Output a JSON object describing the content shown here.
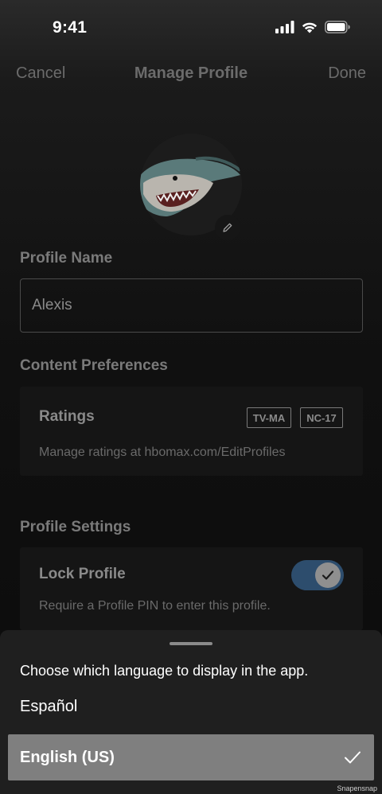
{
  "status_bar": {
    "time": "9:41"
  },
  "nav": {
    "cancel_label": "Cancel",
    "title": "Manage Profile",
    "done_label": "Done"
  },
  "profile_name": {
    "label": "Profile Name",
    "value": "Alexis"
  },
  "content_preferences": {
    "label": "Content Preferences",
    "ratings_title": "Ratings",
    "badges": [
      "TV-MA",
      "NC-17"
    ],
    "subtitle": "Manage ratings at hbomax.com/EditProfiles"
  },
  "profile_settings": {
    "label": "Profile Settings",
    "lock_title": "Lock Profile",
    "lock_subtitle": "Require a Profile PIN to enter this profile.",
    "lock_enabled": true
  },
  "language_sheet": {
    "description": "Choose which language to display in the app.",
    "options": [
      "Español",
      "English (US)"
    ],
    "selected": "English (US)"
  },
  "watermark": "Snapensnap",
  "colors": {
    "toggle_track": "#2d4d6d",
    "selected_row": "#7f7f7f",
    "sheet_bg": "#1f1f1f"
  },
  "icons": {
    "edit": "pencil-icon",
    "check": "checkmark-icon",
    "toggle_check": "checkmark-icon"
  }
}
